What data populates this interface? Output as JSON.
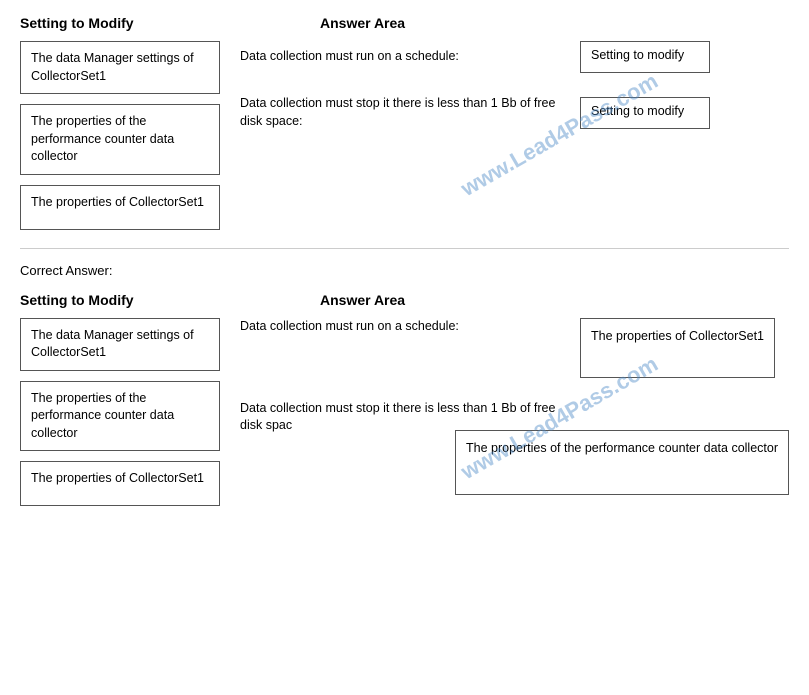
{
  "question_section": {
    "setting_to_modify_label": "Setting to Modify",
    "answer_area_label": "Answer Area",
    "options": [
      {
        "id": "opt1",
        "text": "The data Manager settings of CollectorSet1"
      },
      {
        "id": "opt2",
        "text": "The properties of the performance counter data collector"
      },
      {
        "id": "opt3",
        "text": "The properties of CollectorSet1"
      }
    ],
    "answer_rows": [
      {
        "id": "row1",
        "label": "Data collection must run on a schedule:",
        "placeholder": "Setting to modify"
      },
      {
        "id": "row2",
        "label": "Data collection must stop it there is less than 1 Bb of free disk space:",
        "placeholder": "Setting to modify"
      }
    ]
  },
  "correct_section": {
    "correct_label": "Correct Answer:",
    "setting_to_modify_label": "Setting to Modify",
    "answer_area_label": "Answer Area",
    "options": [
      {
        "id": "copt1",
        "text": "The data Manager settings of CollectorSet1"
      },
      {
        "id": "copt2",
        "text": "The properties of the performance counter data collector"
      },
      {
        "id": "copt3",
        "text": "The properties of CollectorSet1"
      }
    ],
    "answer_rows": [
      {
        "id": "crow1",
        "label": "Data collection must run on a schedule:",
        "answer": "The properties of CollectorSet1"
      },
      {
        "id": "crow2",
        "label": "Data collection must stop it there is less than 1 Bb of free disk spac",
        "answer": "The properties of the performance counter data collector"
      }
    ]
  },
  "watermark": "www.Lead4Pass.com"
}
